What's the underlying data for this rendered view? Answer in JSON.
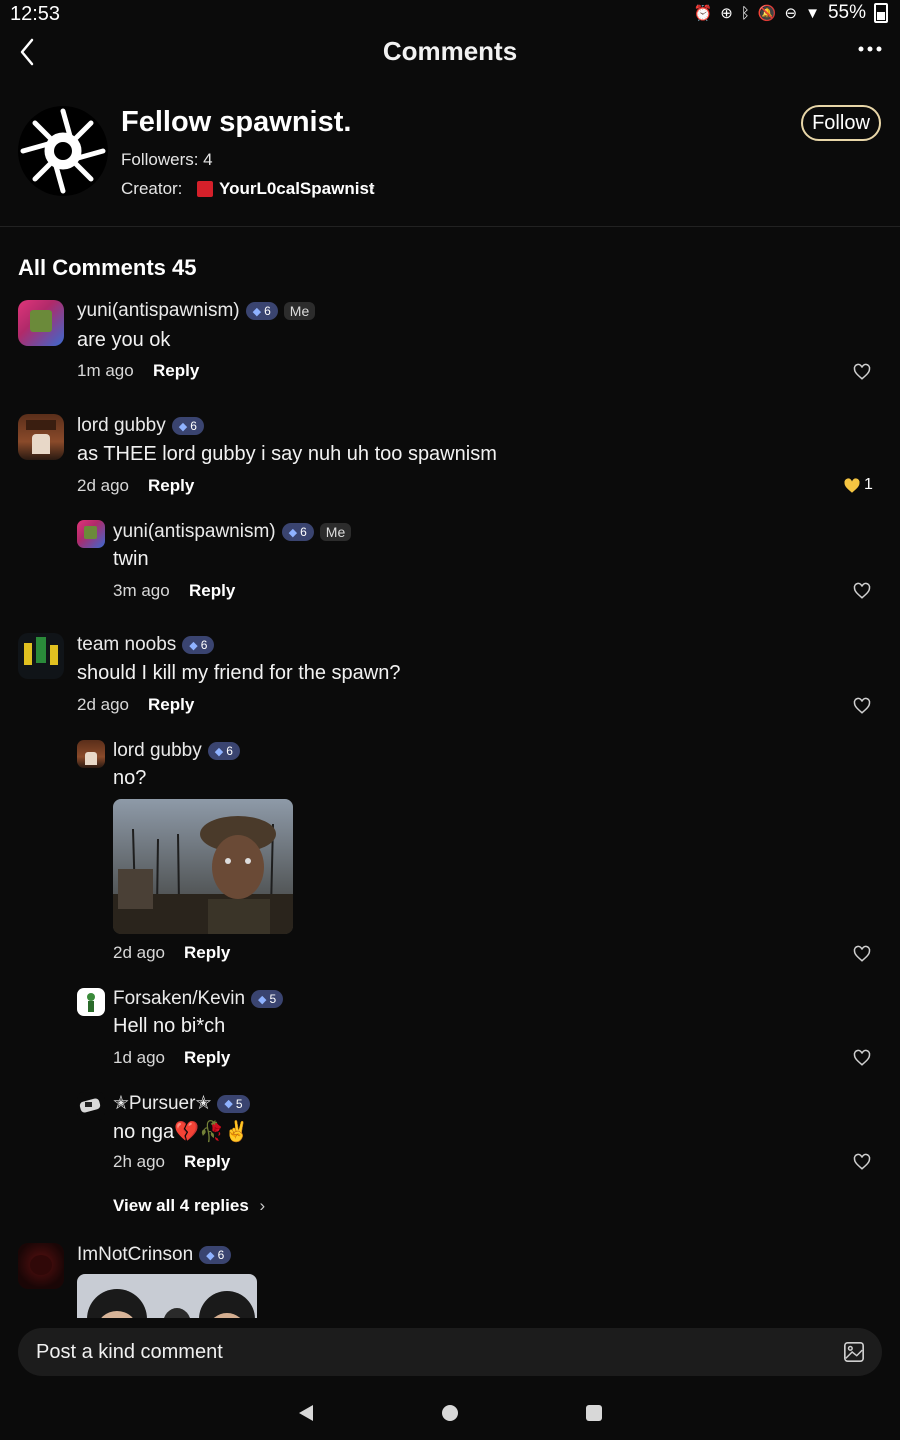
{
  "status_bar": {
    "time": "12:53",
    "battery": "55%"
  },
  "header": {
    "title": "Comments"
  },
  "group": {
    "name": "Fellow spawnist.",
    "followers": "Followers: 4",
    "creator_label": "Creator:",
    "creator_name": "YourL0calSpawnist",
    "follow_label": "Follow"
  },
  "comments_section": {
    "title": "All Comments 45"
  },
  "comments": [
    {
      "user": "yuni(antispawnism)",
      "level": "6",
      "me_badge": "Me",
      "text": "are you ok",
      "time": "1m ago",
      "reply": "Reply"
    },
    {
      "user": "lord gubby",
      "level": "6",
      "text": "as THEE lord gubby i say nuh uh too spawnism",
      "time": "2d ago",
      "reply": "Reply",
      "likes": "1",
      "replies": [
        {
          "user": "yuni(antispawnism)",
          "level": "6",
          "me_badge": "Me",
          "text": "twin",
          "time": "3m ago",
          "reply": "Reply"
        }
      ]
    },
    {
      "user": "team noobs",
      "level": "6",
      "text": "should I kill my friend for the spawn?",
      "time": "2d ago",
      "reply": "Reply",
      "replies": [
        {
          "user": "lord gubby",
          "level": "6",
          "text": "no?",
          "time": "2d ago",
          "reply": "Reply"
        },
        {
          "user": "Forsaken/Kevin",
          "level": "5",
          "text": "Hell no bi*ch",
          "time": "1d ago",
          "reply": "Reply"
        },
        {
          "user": "✭Pursuer✭",
          "level": "5",
          "text": "no nga💔🥀✌",
          "time": "2h ago",
          "reply": "Reply"
        }
      ],
      "view_all": "View all 4 replies"
    },
    {
      "user": "ImNotCrinson",
      "level": "6"
    }
  ],
  "composer": {
    "placeholder": "Post a kind comment"
  },
  "colors": {
    "background": "#0b0b0b",
    "level_badge": "#3a4470",
    "follow_border": "#e8d6a8",
    "liked_heart": "#f5c542"
  }
}
